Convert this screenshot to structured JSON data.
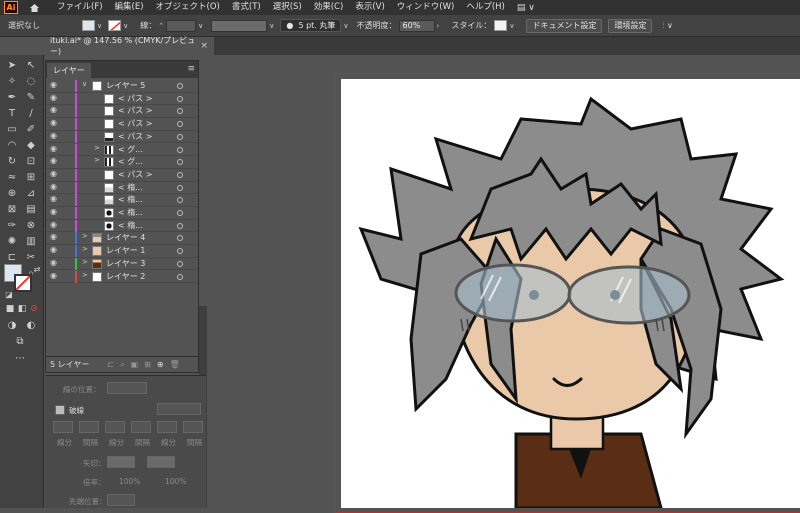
{
  "app": {
    "logo": "Ai"
  },
  "menus": [
    "ファイル(F)",
    "編集(E)",
    "オブジェクト(O)",
    "書式(T)",
    "選択(S)",
    "効果(C)",
    "表示(V)",
    "ウィンドウ(W)",
    "ヘルプ(H)"
  ],
  "controlbar": {
    "selection": "選択なし",
    "stroke_label": "線：",
    "brush": "5 pt. 丸筆",
    "opacity_label": "不透明度：",
    "opacity_value": "60%",
    "style_label": "スタイル：",
    "doc_settings": "ドキュメント設定",
    "prefs": "環境設定"
  },
  "document": {
    "tab_title": "ituki.ai* @ 147.56 % (CMYK/プレビュー)",
    "close": "×"
  },
  "layers_panel": {
    "tab": "レイヤー",
    "footer_count": "5 レイヤー",
    "rows": [
      {
        "name": "レイヤー 5",
        "color": "#c94dd6",
        "arrow": "∨",
        "level": 0
      },
      {
        "name": "< パス >",
        "color": "#c94dd6",
        "arrow": "",
        "level": 1
      },
      {
        "name": "< パス >",
        "color": "#c94dd6",
        "arrow": "",
        "level": 1
      },
      {
        "name": "< パス >",
        "color": "#c94dd6",
        "arrow": "",
        "level": 1
      },
      {
        "name": "< パス >",
        "color": "#c94dd6",
        "arrow": "",
        "level": 1
      },
      {
        "name": "< グ...",
        "color": "#c94dd6",
        "arrow": ">",
        "level": 1
      },
      {
        "name": "< グ...",
        "color": "#c94dd6",
        "arrow": ">",
        "level": 1
      },
      {
        "name": "< パス >",
        "color": "#c94dd6",
        "arrow": "",
        "level": 1
      },
      {
        "name": "< 楕...",
        "color": "#c94dd6",
        "arrow": "",
        "level": 1
      },
      {
        "name": "< 楕...",
        "color": "#c94dd6",
        "arrow": "",
        "level": 1
      },
      {
        "name": "< 楕...",
        "color": "#c94dd6",
        "arrow": "",
        "level": 1
      },
      {
        "name": "< 楕...",
        "color": "#c94dd6",
        "arrow": "",
        "level": 1
      },
      {
        "name": "レイヤー 4",
        "color": "#4f6fd6",
        "arrow": ">",
        "level": 0
      },
      {
        "name": "レイヤー 1",
        "color": "#4f6fd6",
        "arrow": ">",
        "level": 0
      },
      {
        "name": "レイヤー 3",
        "color": "#3fbf4a",
        "arrow": ">",
        "level": 0
      },
      {
        "name": "レイヤー 2",
        "color": "#d64a4a",
        "arrow": ">",
        "level": 0
      }
    ]
  },
  "lower_panel": {
    "align_label": "線の位置：",
    "stroke_section": "破線",
    "labels": [
      "線分",
      "間隔",
      "線分",
      "間隔",
      "線分",
      "間隔"
    ],
    "arrow_label": "矢印：",
    "scale_label": "倍率：",
    "scale1": "100%",
    "scale2": "100%",
    "tip_label": "先端位置："
  },
  "colors": {
    "hair": "#8c8c8c",
    "skin": "#e9c9a7",
    "outline": "#111111",
    "glasses": "#a9bfcf",
    "coat": "#5a2e14"
  }
}
